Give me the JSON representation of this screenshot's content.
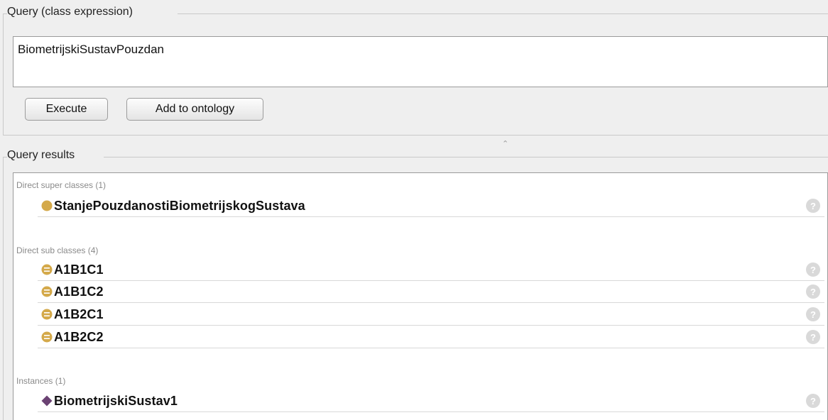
{
  "query": {
    "group_title": "Query (class expression)",
    "expression": "BiometrijskiSustavPouzdan",
    "execute_label": "Execute",
    "add_label": "Add to ontology"
  },
  "results": {
    "group_title": "Query results",
    "super_classes": {
      "label": "Direct super classes (1)",
      "items": [
        {
          "name": "StanjePouzdanostiBiometrijskogSustava",
          "icon": "class-icon"
        }
      ]
    },
    "sub_classes": {
      "label": "Direct sub classes (4)",
      "items": [
        {
          "name": "A1B1C1",
          "icon": "defined-class-icon"
        },
        {
          "name": "A1B1C2",
          "icon": "defined-class-icon"
        },
        {
          "name": "A1B2C1",
          "icon": "defined-class-icon"
        },
        {
          "name": "A1B2C2",
          "icon": "defined-class-icon"
        }
      ]
    },
    "instances": {
      "label": "Instances (1)",
      "items": [
        {
          "name": "BiometrijskiSustav1",
          "icon": "individual-icon"
        }
      ]
    },
    "help_glyph": "?"
  },
  "colors": {
    "class_icon": "#d4a94a",
    "individual_icon": "#6b4273"
  }
}
